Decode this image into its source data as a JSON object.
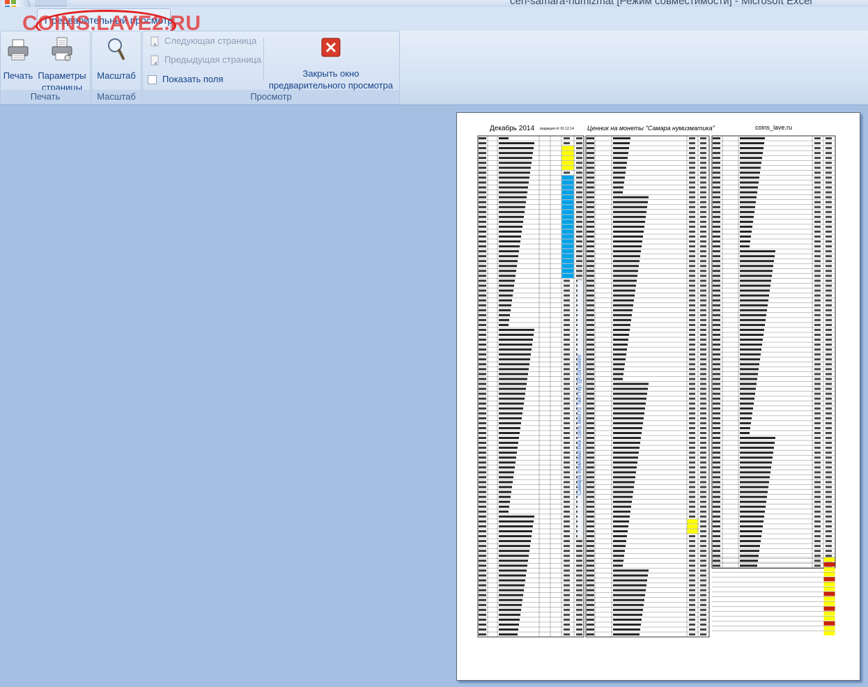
{
  "window": {
    "title": "cen-samara-numizmat [Режим совместимости] - Microsoft Excel",
    "active_tab": "Предварительный просмотр",
    "watermark": "COINS.LAVE2.RU"
  },
  "ribbon": {
    "groups": {
      "print": {
        "label": "Печать",
        "print_button": "Печать",
        "page_setup_line1": "Параметры",
        "page_setup_line2": "страницы"
      },
      "zoom": {
        "label": "Масштаб",
        "zoom_button": "Масштаб"
      },
      "preview": {
        "label": "Просмотр",
        "next_page": "Следующая страница",
        "prev_page": "Предыдущая страница",
        "show_margins": "Показать поля",
        "close_line1": "Закрыть окно",
        "close_line2": "предварительного просмотра"
      }
    }
  },
  "sheet": {
    "month": "Декабрь 2014",
    "edition": "редакция от 01.12.14",
    "heading": "Ценник на монеты \"Самара нумизматика\"",
    "site": "coins_lave.ru",
    "vertical_text": "Самара нумизматика coins.lave.ru  Твиттер @coinslave",
    "col1_header": [
      "Год",
      "Ном",
      "Наименование",
      "Обыч",
      "Ц",
      "ПРУФ",
      "оф"
    ],
    "col2_header": [
      "Год",
      "Номинал",
      "Наименование",
      "отлич",
      "хор"
    ],
    "col3_header": [
      "Год",
      "Номинал",
      "Наименование",
      "отлич",
      "хор"
    ],
    "rows_col1": 102,
    "rows_col2": 102,
    "rows_col3": 88
  },
  "colors": {
    "ribbon_text": "#15428b",
    "watermark": "#e23a3a",
    "workspace": "#a4bfe2",
    "cell_yellow": "#ffff00",
    "cell_blue": "#00a2e8",
    "cell_red": "#cc2200"
  },
  "icons": [
    "office-button-icon",
    "printer-icon",
    "page-setup-icon",
    "magnifier-icon",
    "next-page-icon",
    "prev-page-icon",
    "close-preview-icon"
  ]
}
